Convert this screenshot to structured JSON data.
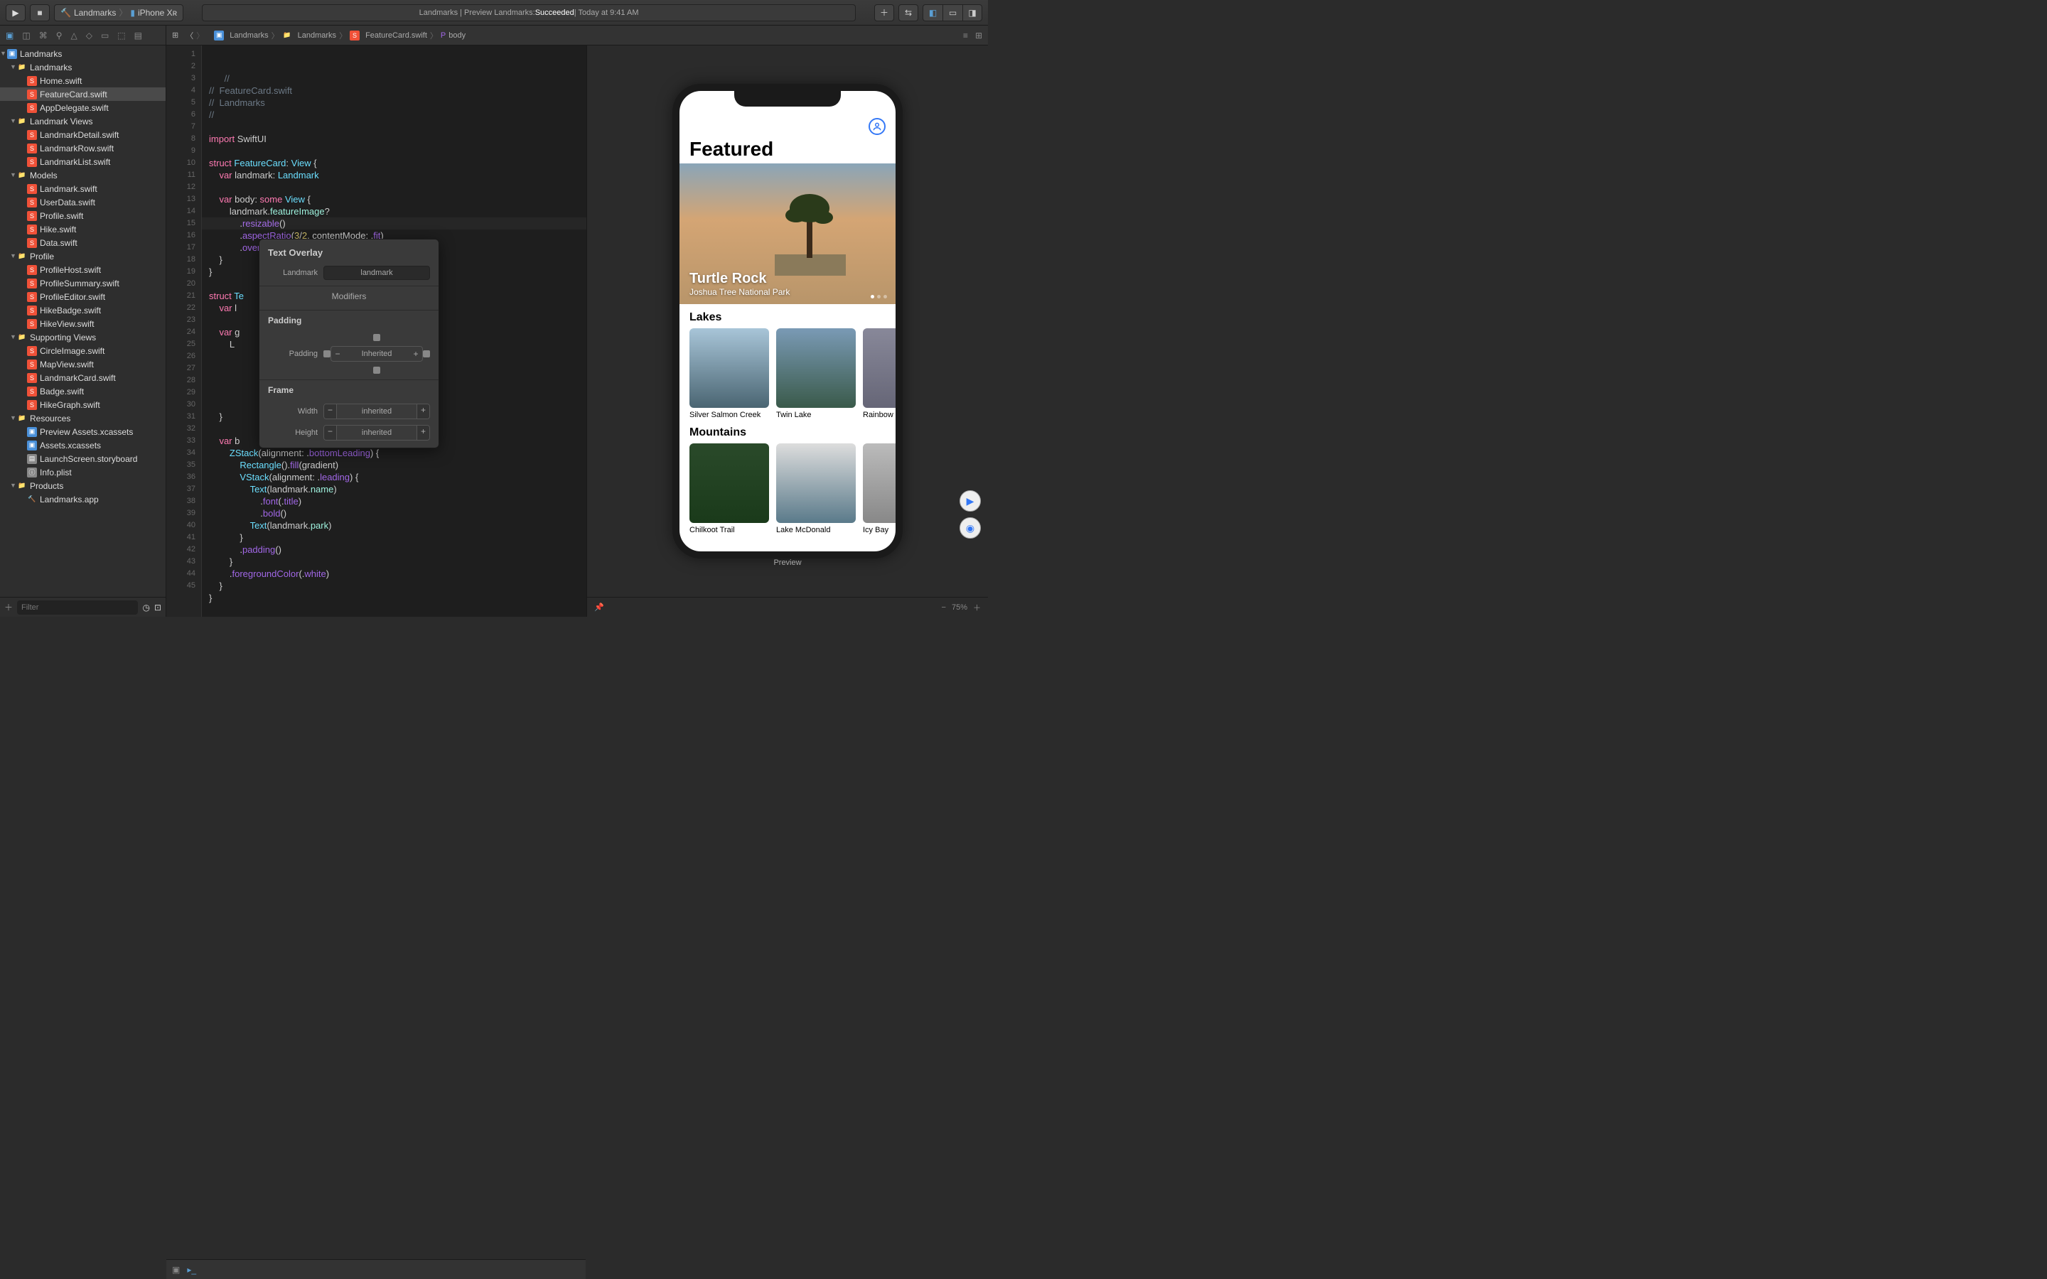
{
  "toolbar": {
    "scheme": "Landmarks",
    "destination": "iPhone Xʀ",
    "status_prefix": "Landmarks | Preview Landmarks: ",
    "status_result": "Succeeded",
    "status_suffix": " | Today at 9:41 AM"
  },
  "jumpbar": {
    "items": [
      "Landmarks",
      "Landmarks",
      "FeatureCard.swift",
      "body"
    ]
  },
  "navigator": {
    "project": "Landmarks",
    "groups": [
      {
        "name": "Landmarks",
        "children": [
          {
            "name": "Home.swift",
            "type": "swift"
          },
          {
            "name": "FeatureCard.swift",
            "type": "swift",
            "selected": true
          },
          {
            "name": "AppDelegate.swift",
            "type": "swift"
          }
        ]
      },
      {
        "name": "Landmark Views",
        "children": [
          {
            "name": "LandmarkDetail.swift",
            "type": "swift"
          },
          {
            "name": "LandmarkRow.swift",
            "type": "swift"
          },
          {
            "name": "LandmarkList.swift",
            "type": "swift"
          }
        ]
      },
      {
        "name": "Models",
        "children": [
          {
            "name": "Landmark.swift",
            "type": "swift"
          },
          {
            "name": "UserData.swift",
            "type": "swift"
          },
          {
            "name": "Profile.swift",
            "type": "swift"
          },
          {
            "name": "Hike.swift",
            "type": "swift"
          },
          {
            "name": "Data.swift",
            "type": "swift"
          }
        ]
      },
      {
        "name": "Profile",
        "children": [
          {
            "name": "ProfileHost.swift",
            "type": "swift"
          },
          {
            "name": "ProfileSummary.swift",
            "type": "swift"
          },
          {
            "name": "ProfileEditor.swift",
            "type": "swift"
          },
          {
            "name": "HikeBadge.swift",
            "type": "swift"
          },
          {
            "name": "HikeView.swift",
            "type": "swift"
          }
        ]
      },
      {
        "name": "Supporting Views",
        "children": [
          {
            "name": "CircleImage.swift",
            "type": "swift"
          },
          {
            "name": "MapView.swift",
            "type": "swift"
          },
          {
            "name": "LandmarkCard.swift",
            "type": "swift"
          },
          {
            "name": "Badge.swift",
            "type": "swift"
          },
          {
            "name": "HikeGraph.swift",
            "type": "swift"
          }
        ]
      },
      {
        "name": "Resources",
        "children": [
          {
            "name": "Preview Assets.xcassets",
            "type": "assets"
          },
          {
            "name": "Assets.xcassets",
            "type": "assets"
          },
          {
            "name": "LaunchScreen.storyboard",
            "type": "sb"
          },
          {
            "name": "Info.plist",
            "type": "plist"
          }
        ]
      },
      {
        "name": "Products",
        "children": [
          {
            "name": "Landmarks.app",
            "type": "app"
          }
        ]
      }
    ],
    "filter_placeholder": "Filter"
  },
  "editor": {
    "lines": [
      "1",
      "2",
      "3",
      "4",
      "5",
      "6",
      "7",
      "8",
      "9",
      "10",
      "11",
      "12",
      "13",
      "14",
      "15",
      "16",
      "17",
      "18",
      "19",
      "20",
      "21",
      "22",
      "23",
      "24",
      "25",
      "26",
      "27",
      "28",
      "29",
      "30",
      "31",
      "32",
      "33",
      "34",
      "35",
      "36",
      "37",
      "38",
      "39",
      "40",
      "41",
      "42",
      "43",
      "44",
      "45"
    ],
    "current_line": 15,
    "code_html": "<span class='c'>//</span>\n<span class='c'>//  FeatureCard.swift</span>\n<span class='c'>//  Landmarks</span>\n<span class='c'>//</span>\n\n<span class='k'>import</span> SwiftUI\n\n<span class='k'>struct</span> <span class='t'>FeatureCard</span>: <span class='t'>View</span> {\n    <span class='k'>var</span> landmark: <span class='t'>Landmark</span>\n\n    <span class='k'>var</span> body: <span class='k'>some</span> <span class='t'>View</span> {\n        landmark.<span class='id'>featureImage</span>?\n            .<span class='fn'>resizable</span>()\n            .<span class='fn'>aspectRatio</span>(<span class='n'>3</span>/<span class='n'>2</span>, contentMode: .<span class='fn'>fit</span>)\n            .<span class='fn'>overlay</span>(<span class='hl'>TextOverlay(landmark: landmark)</span>)\n    }\n}\n\n<span class='k'>struct</span> <span class='t'>Te</span>\n    <span class='k'>var</span> l\n\n    <span class='k'>var</span> g\n        L\n\n\n\n\n\n    }\n\n    <span class='k'>var</span> b\n        <span class='t'>ZStack</span>(alignment: .<span class='fn'>bottomLeading</span>) {\n            <span class='t'>Rectangle</span>().<span class='fn'>fill</span>(gradient)\n            <span class='t'>VStack</span>(alignment: .<span class='fn'>leading</span>) {\n                <span class='t'>Text</span>(landmark.<span class='id'>name</span>)\n                    .<span class='fn'>font</span>(.<span class='fn'>title</span>)\n                    .<span class='fn'>bold</span>()\n                <span class='t'>Text</span>(landmark.<span class='id'>park</span>)\n            }\n            .<span class='fn'>padding</span>()\n        }\n        .<span class='fn'>foregroundColor</span>(.<span class='fn'>white</span>)\n    }\n}\n"
  },
  "popover": {
    "title": "Text Overlay",
    "landmark_label": "Landmark",
    "landmark_value": "landmark",
    "modifiers_label": "Modifiers",
    "padding_section": "Padding",
    "padding_label": "Padding",
    "padding_value": "Inherited",
    "frame_section": "Frame",
    "width_label": "Width",
    "width_value": "inherited",
    "height_label": "Height",
    "height_value": "inherited"
  },
  "preview": {
    "label": "Preview",
    "featured": "Featured",
    "hero_name": "Turtle Rock",
    "hero_park": "Joshua Tree National Park",
    "lakes_title": "Lakes",
    "lakes": [
      "Silver Salmon Creek",
      "Twin Lake",
      "Rainbow L"
    ],
    "mountains_title": "Mountains",
    "mountains": [
      "Chilkoot Trail",
      "Lake McDonald",
      "Icy Bay"
    ],
    "zoom": "75%"
  }
}
